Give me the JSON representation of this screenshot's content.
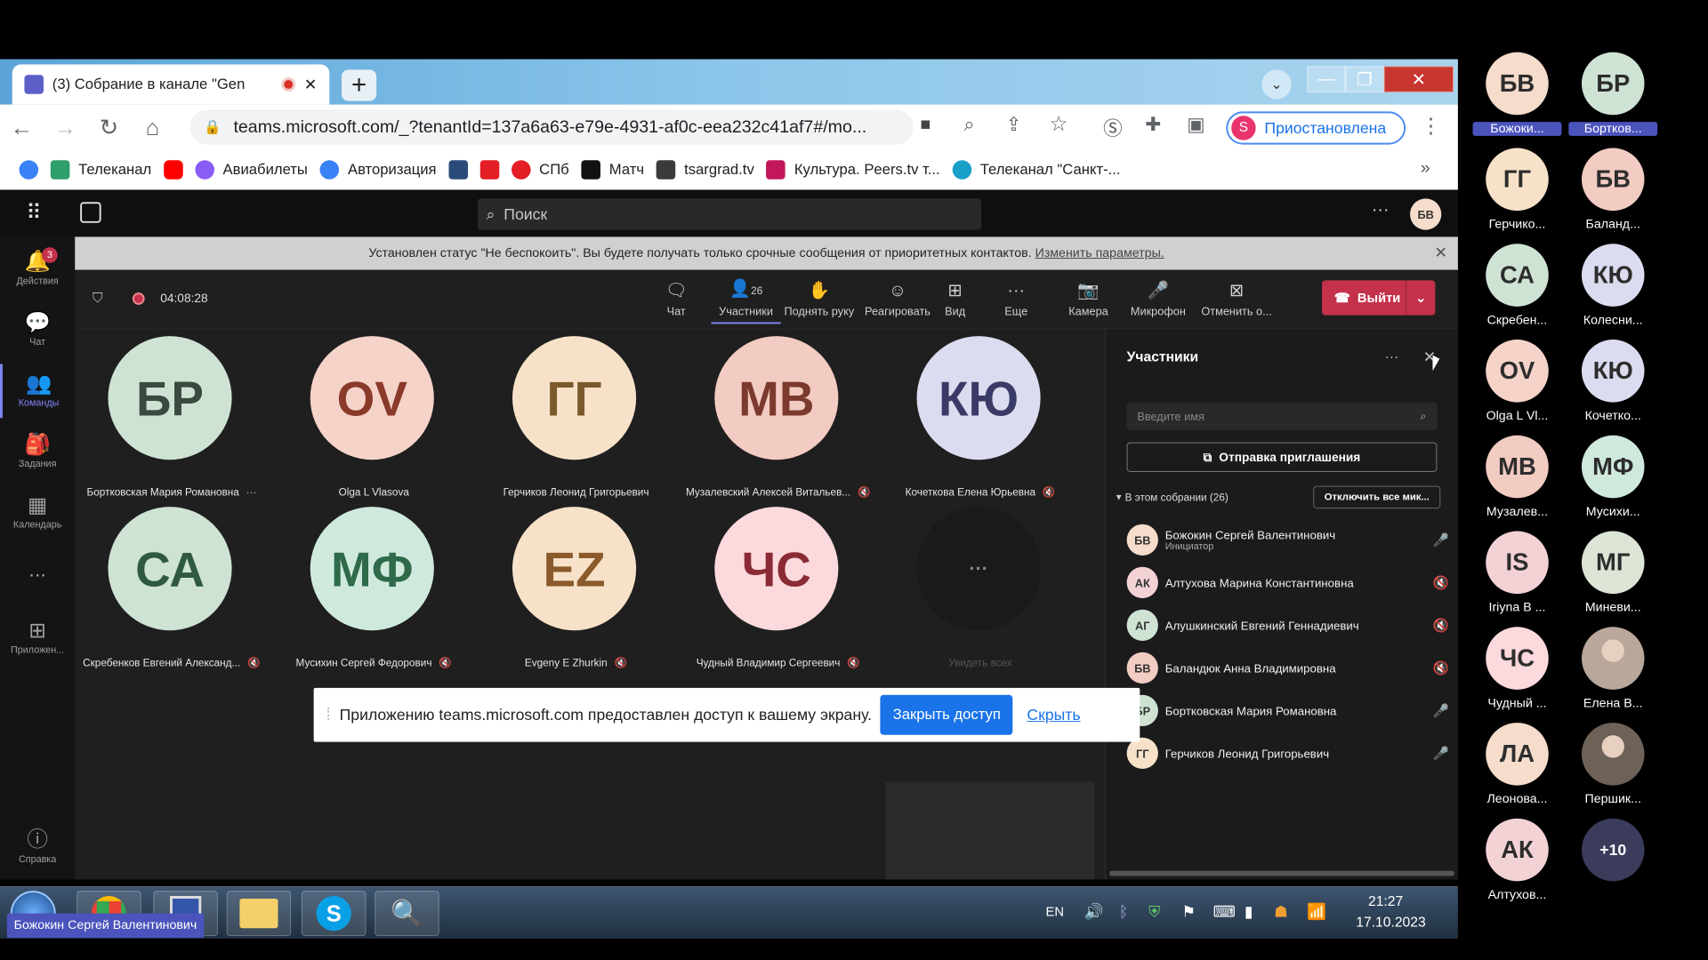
{
  "browser": {
    "tab_title": "(3) Собрание в канале \"Gen",
    "url": "teams.microsoft.com/_?tenantId=137a6a63-e79e-4931-af0c-eea232c41af7#/mo...",
    "profile_status": "Приостановлена",
    "profile_initial": "S",
    "bookmarks": [
      "Телеканал",
      "Авиабилеты",
      "Авторизация",
      "СПб",
      "Матч",
      "tsargrad.tv",
      "Культура. Peers.tv т...",
      "Телеканал \"Санкт-..."
    ]
  },
  "teams": {
    "search_placeholder": "Поиск",
    "user_initials": "БВ",
    "rail": [
      {
        "label": "Действия",
        "badge": "3"
      },
      {
        "label": "Чат"
      },
      {
        "label": "Команды"
      },
      {
        "label": "Задания"
      },
      {
        "label": "Календарь"
      },
      {
        "label": "..."
      },
      {
        "label": "Приложен..."
      },
      {
        "label": "Справка"
      }
    ],
    "banner_text": "Установлен статус \"Не беспокоить\". Вы будете получать только срочные сообщения от приоритетных контактов.",
    "banner_link": "Изменить параметры.",
    "meeting_timer": "04:08:28",
    "toolbar": {
      "chat": "Чат",
      "participants": "Участники",
      "participants_count": "26",
      "raise_hand": "Поднять руку",
      "react": "Реагировать",
      "view": "Вид",
      "more": "Еще",
      "camera": "Камера",
      "mic": "Микрофон",
      "stop_share": "Отменить о...",
      "leave": "Выйти"
    },
    "tiles": [
      {
        "initials": "БР",
        "name": "Бортковская Мария Романовна",
        "bg": "#cfe3d5",
        "fg": "#3a4a3f"
      },
      {
        "initials": "OV",
        "name": "Olga L Vlasova",
        "bg": "#f6d3c9",
        "fg": "#8a3a2a"
      },
      {
        "initials": "ГГ",
        "name": "Герчиков Леонид Григорьевич",
        "bg": "#f7e2c9",
        "fg": "#7a5a2c"
      },
      {
        "initials": "МВ",
        "name": "Музалевский Алексей Витальев...",
        "bg": "#f2cbc2",
        "fg": "#7c3a2e"
      },
      {
        "initials": "КЮ",
        "name": "Кочеткова Елена Юрьевна",
        "bg": "#dcdcf0",
        "fg": "#3a3a66"
      },
      {
        "initials": "СА",
        "name": "Скребенков Евгений Александ...",
        "bg": "#cfe3d5",
        "fg": "#2f5a3f"
      },
      {
        "initials": "МФ",
        "name": "Мусихин Сергей Федорович",
        "bg": "#cfeadd",
        "fg": "#2f6a4a"
      },
      {
        "initials": "EZ",
        "name": "Evgeny E Zhurkin",
        "bg": "#f7e2c9",
        "fg": "#8a5a2a"
      },
      {
        "initials": "ЧС",
        "name": "Чудный Владимир Сергеевич",
        "bg": "#fbd9dc",
        "fg": "#8a2a34"
      },
      {
        "initials": "···",
        "name": "Увидеть всех",
        "bg": "#1a1a1a",
        "fg": "#888"
      }
    ],
    "panel": {
      "title": "Участники",
      "search_placeholder": "Введите имя",
      "invite_button": "Отправка приглашения",
      "section_label": "В этом собрании (26)",
      "mute_all_button": "Отключить все мик...",
      "people": [
        {
          "initials": "БВ",
          "name": "Божокин Сергей Валентинович",
          "role": "Инициатор",
          "bg": "#f5dccb",
          "mic": "on"
        },
        {
          "initials": "АК",
          "name": "Алтухова Марина Константиновна",
          "bg": "#f3d2d6",
          "mic": "off"
        },
        {
          "initials": "АГ",
          "name": "Алушкинский Евгений Геннадиевич",
          "bg": "#cfe3d5",
          "mic": "off"
        },
        {
          "initials": "БВ",
          "name": "Баландюк Анна Владимировна",
          "bg": "#f2cbc2",
          "mic": "off"
        },
        {
          "initials": "БР",
          "name": "Бортковская Мария Романовна",
          "bg": "#cfe3d5",
          "mic": "on"
        },
        {
          "initials": "ГГ",
          "name": "Герчиков Леонид Григорьевич",
          "bg": "#f7e2c9",
          "mic": "on"
        }
      ]
    }
  },
  "share_notice": {
    "text": "Приложению teams.microsoft.com предоставлен доступ к вашему экрану.",
    "stop_button": "Закрыть доступ",
    "hide_link": "Скрыть"
  },
  "taskbar": {
    "lang": "EN",
    "time": "21:27",
    "date": "17.10.2023"
  },
  "gallery": [
    {
      "initials": "БВ",
      "name": "Божоки...",
      "bg": "#f5dccb",
      "highlight": true
    },
    {
      "initials": "БР",
      "name": "Бортков...",
      "bg": "#cfe3d5",
      "highlight": true
    },
    {
      "initials": "ГГ",
      "name": "Герчико...",
      "bg": "#f7e2c9"
    },
    {
      "initials": "БВ",
      "name": "Баланд...",
      "bg": "#f2cbc2"
    },
    {
      "initials": "СА",
      "name": "Скребен...",
      "bg": "#cfe3d5"
    },
    {
      "initials": "КЮ",
      "name": "Колесни...",
      "bg": "#dcdcf0"
    },
    {
      "initials": "OV",
      "name": "Olga L Vl...",
      "bg": "#f6d3c9"
    },
    {
      "initials": "КЮ",
      "name": "Кочетко...",
      "bg": "#dcdcf0"
    },
    {
      "initials": "МВ",
      "name": "Музалев...",
      "bg": "#f2cbc2"
    },
    {
      "initials": "МФ",
      "name": "Мусихи...",
      "bg": "#cfeadd"
    },
    {
      "initials": "IS",
      "name": "Iriyna B ...",
      "bg": "#f3d2d6"
    },
    {
      "initials": "МГ",
      "name": "Миневи...",
      "bg": "#dde6d6"
    },
    {
      "initials": "ЧС",
      "name": "Чудный ...",
      "bg": "#fbd9dc"
    },
    {
      "initials": "",
      "name": "Елена В...",
      "bg": "#b8a79a",
      "photo": true
    },
    {
      "initials": "ЛА",
      "name": "Леонова...",
      "bg": "#f5dccb"
    },
    {
      "initials": "",
      "name": "Першик...",
      "bg": "#6e6258",
      "photo": true
    },
    {
      "initials": "АК",
      "name": "Алтухов...",
      "bg": "#f3d2d6"
    },
    {
      "initials": "+10",
      "name": "",
      "bg": "#3b3b5c"
    }
  ],
  "presenter_label": "Божокин Сергей Валентинович"
}
